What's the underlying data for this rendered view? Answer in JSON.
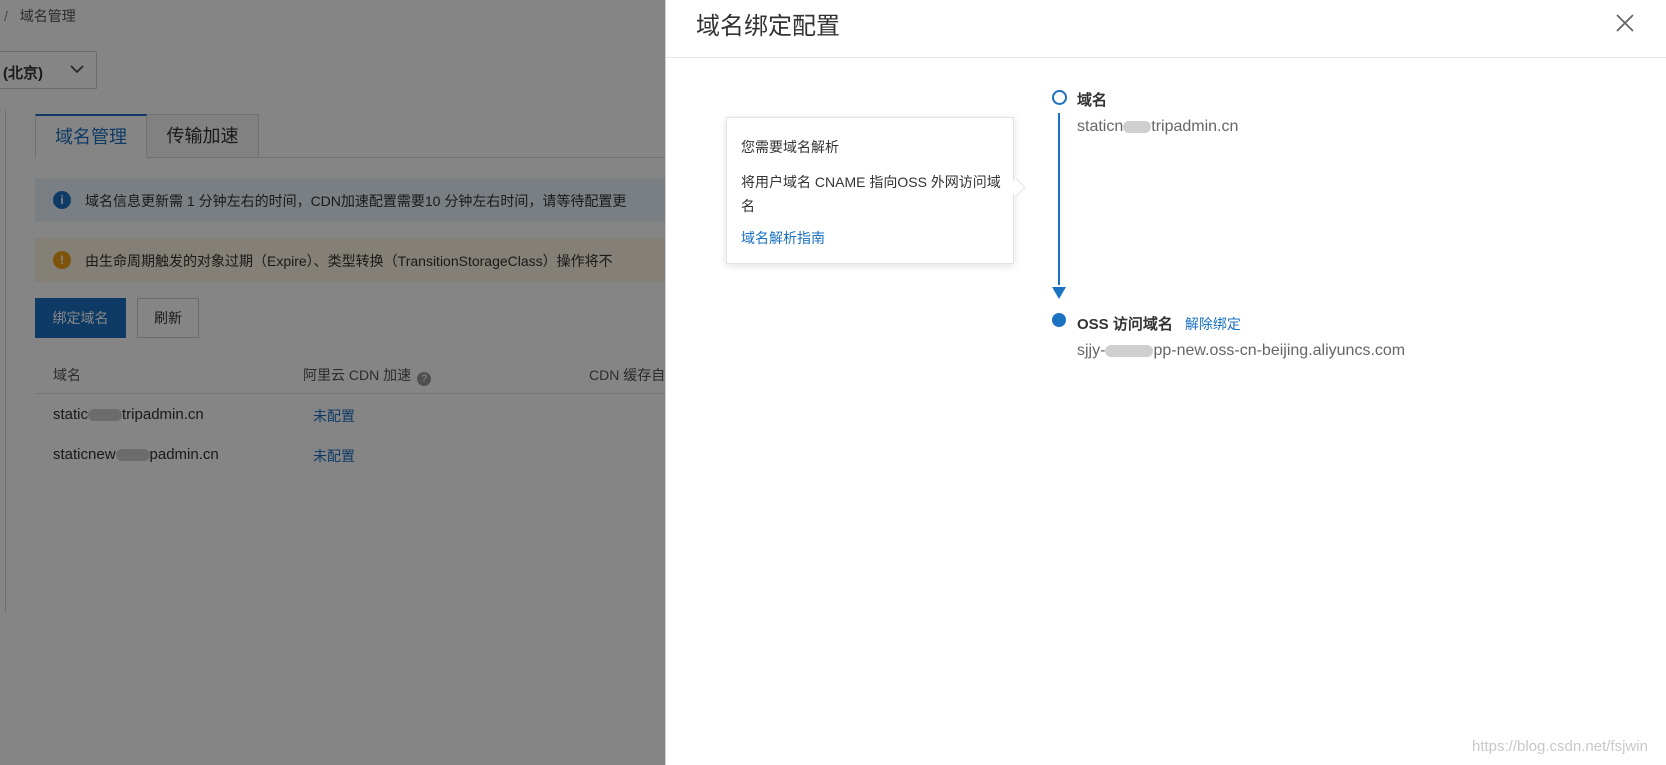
{
  "background": {
    "breadcrumb": {
      "separator": "/",
      "current": "域名管理"
    },
    "region_select": {
      "value": "(北京)"
    },
    "tabs": [
      {
        "label": "域名管理",
        "active": true
      },
      {
        "label": "传输加速",
        "active": false
      }
    ],
    "alerts": {
      "info": "域名信息更新需 1 分钟左右的时间，CDN加速配置需要10 分钟左右时间，请等待配置更",
      "warn": "由生命周期触发的对象过期（Expire）、类型转换（TransitionStorageClass）操作将不"
    },
    "buttons": {
      "bind": "绑定域名",
      "refresh": "刷新"
    },
    "table": {
      "headers": [
        "域名",
        "阿里云 CDN 加速",
        "CDN 缓存自"
      ],
      "rows": [
        {
          "domain_prefix": "static",
          "domain_suffix": "tripadmin.cn",
          "cdn": "未配置"
        },
        {
          "domain_prefix": "staticnew",
          "domain_suffix": "padmin.cn",
          "cdn": "未配置"
        }
      ]
    }
  },
  "drawer": {
    "title": "域名绑定配置",
    "popover": {
      "line1": "您需要域名解析",
      "line2": "将用户域名 CNAME 指向OSS 外网访问域名",
      "link": "域名解析指南"
    },
    "steps": [
      {
        "label": "域名",
        "value_prefix": "staticn",
        "value_suffix": "tripadmin.cn"
      },
      {
        "label": "OSS 访问域名",
        "action": "解除绑定",
        "value_prefix": "sjjy-",
        "value_suffix": "pp-new.oss-cn-beijing.aliyuncs.com"
      }
    ]
  },
  "watermark": "https://blog.csdn.net/fsjwin",
  "colors": {
    "accent": "#1b72c3",
    "overlay": "rgba(0,0,0,0.48)",
    "info_bg": "#eaf3fb",
    "warn_bg": "#fdf6e4",
    "warn_icon": "#f2a216"
  }
}
